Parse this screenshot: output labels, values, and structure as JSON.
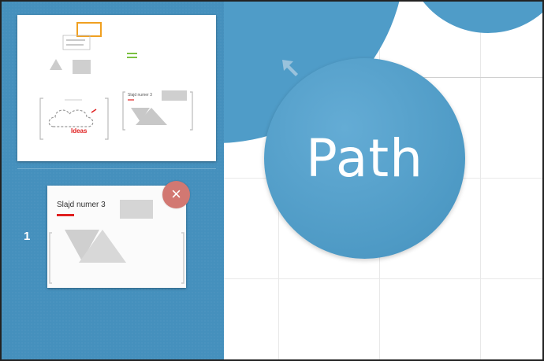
{
  "sidebar": {
    "slide_number": "1",
    "slide_thumbnail": {
      "title": "Slajd numer 3"
    },
    "overview_thumbnail": {
      "title": "Slajd numer 3",
      "ideas_label": "Ideas"
    },
    "delete_icon": "×"
  },
  "canvas": {
    "path_label": "Path"
  },
  "colors": {
    "sidebar": "#4590bd",
    "circle": "#4f9cc8",
    "delete": "#d27872",
    "accent_red": "#e02020",
    "highlight_orange": "#f0a020",
    "highlight_green": "#7bc142"
  }
}
